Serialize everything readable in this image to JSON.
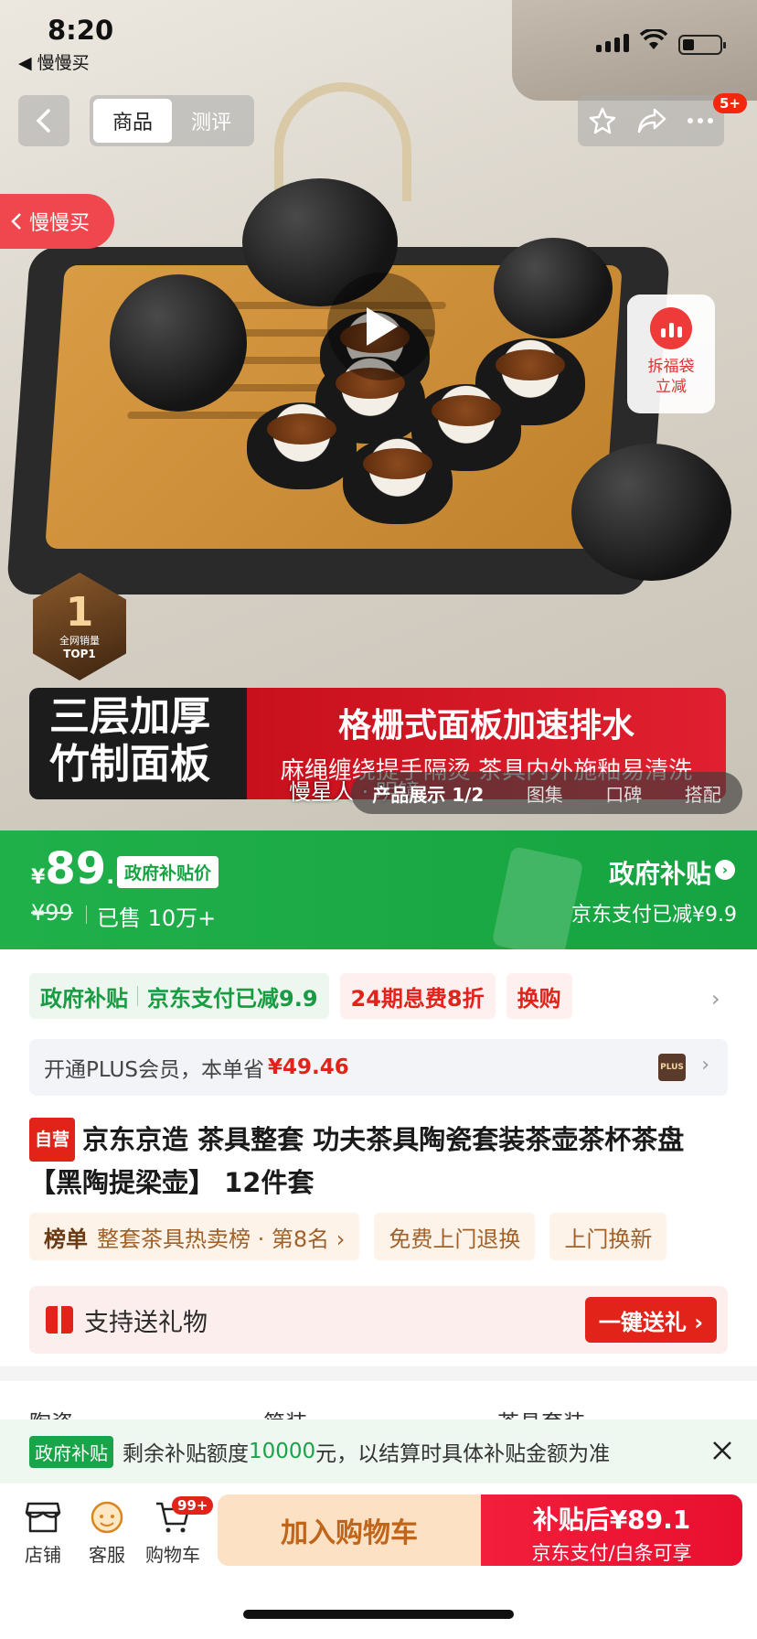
{
  "status_bar": {
    "time": "8:20",
    "back_app": "◀ 慢慢买"
  },
  "nav": {
    "tab_product": "商品",
    "tab_review": "测评",
    "badge": "5+"
  },
  "hero": {
    "slow_buy": "慢慢买",
    "lucky_bag": "拆福袋\n立减",
    "top1_rank": "1",
    "top1_line1": "全网销量",
    "top1_line2": "TOP1",
    "banner_left": "三层加厚\n竹制面板",
    "banner_right_1": "格栅式面板加速排水",
    "banner_right_2": "麻绳缠绕提手隔烫 茶具内外施釉易清洗",
    "caption": "慢星人 · 明镜",
    "gallery_tabs": [
      "产品展示 1/2",
      "图集",
      "口碑",
      "搭配"
    ]
  },
  "price_bar": {
    "yen": "¥",
    "price_int": "89",
    "price_dec": ".1",
    "gov_tag": "政府补贴价",
    "original": "¥99",
    "sold": "已售 10万+",
    "gov_subsidy": "政府补贴",
    "gov_subsidy_detail": "京东支付已减¥9.9"
  },
  "promos": {
    "gov_label": "政府补贴",
    "gov_detail": "京东支付已减9.9",
    "installment": "24期息费8折",
    "exchange": "换购"
  },
  "plus": {
    "text": "开通PLUS会员，本单省",
    "amount": "¥49.46",
    "icon": "PLUS"
  },
  "product": {
    "self_tag": "自营",
    "title": "京东京造 茶具整套 功夫茶具陶瓷套装茶壶茶杯茶盘【黑陶提梁壶】 12件套"
  },
  "ranks": {
    "rank_label": "榜单",
    "rank_text": "整套茶具热卖榜 · 第8名 ›",
    "free_return": "免费上门退换",
    "door_replace": "上门换新"
  },
  "gift": {
    "text": "支持送礼物",
    "button": "一键送礼 ›"
  },
  "specs": [
    "陶瓷",
    "简装",
    "茶具套装"
  ],
  "notice": {
    "tag": "政府补贴",
    "text_pre": "剩余补贴额度",
    "amount": "10000",
    "text_post": "元，以结算时具体补贴金额为准"
  },
  "bottom": {
    "store": "店铺",
    "service": "客服",
    "cart": "购物车",
    "cart_badge": "99+",
    "add_cart": "加入购物车",
    "buy_line1": "补贴后¥89.1",
    "buy_line2": "京东支付/白条可享"
  },
  "colors": {
    "jd_red": "#e2231a",
    "gov_green": "#16a341"
  }
}
